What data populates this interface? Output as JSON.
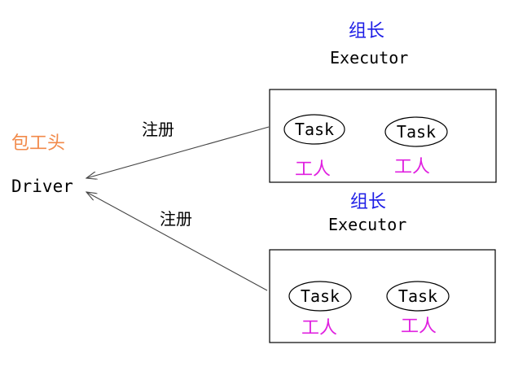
{
  "colors": {
    "boss": "#F28A4A",
    "leader": "#1D1DE6",
    "worker": "#E020E0",
    "ink": "#000000",
    "line": "#444444"
  },
  "driver": {
    "role": "包工头",
    "label": "Driver"
  },
  "register_labels": [
    "注册",
    "注册"
  ],
  "executors": [
    {
      "role": "组长",
      "label": "Executor",
      "tasks": [
        {
          "label": "Task",
          "worker": "工人"
        },
        {
          "label": "Task",
          "worker": "工人"
        }
      ]
    },
    {
      "role": "组长",
      "label": "Executor",
      "tasks": [
        {
          "label": "Task",
          "worker": "工人"
        },
        {
          "label": "Task",
          "worker": "工人"
        }
      ]
    }
  ]
}
